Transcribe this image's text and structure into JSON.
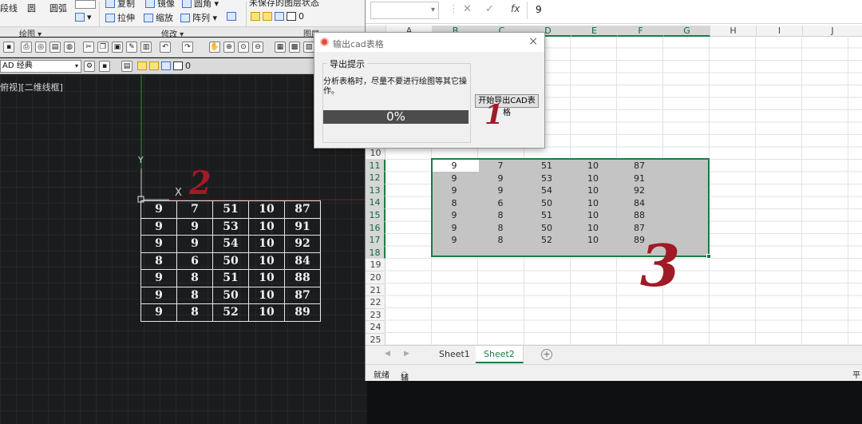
{
  "cad": {
    "ribbon": {
      "draw_items": [
        "段线",
        "圆",
        "圆弧"
      ],
      "modify_items": [
        "复制",
        "镜像",
        "圆角",
        "拉伸",
        "缩放",
        "阵列"
      ],
      "layer_state": "未保存的图层状态",
      "layer_zero": "0",
      "groups": {
        "draw": "绘图 ▾",
        "modify": "修改 ▾",
        "layer": "图层 ▾"
      }
    },
    "workspace": "AD 经典",
    "layer_value": "0",
    "viewport_label": "俯视][二维线框]",
    "ucs_y": "Y",
    "ucs_x": "X",
    "table": [
      [
        "9",
        "7",
        "51",
        "10",
        "87"
      ],
      [
        "9",
        "9",
        "53",
        "10",
        "91"
      ],
      [
        "9",
        "9",
        "54",
        "10",
        "92"
      ],
      [
        "8",
        "6",
        "50",
        "10",
        "84"
      ],
      [
        "9",
        "8",
        "51",
        "10",
        "88"
      ],
      [
        "9",
        "8",
        "50",
        "10",
        "87"
      ],
      [
        "9",
        "8",
        "52",
        "10",
        "89"
      ]
    ]
  },
  "excel": {
    "formula_value": "9",
    "fx": "fx",
    "columns": [
      "A",
      "B",
      "C",
      "D",
      "E",
      "F",
      "G",
      "H",
      "I",
      "J"
    ],
    "rows_visible": [
      "10",
      "11",
      "12",
      "13",
      "14",
      "15",
      "16",
      "17",
      "18",
      "19",
      "20",
      "21",
      "22",
      "23",
      "24",
      "25"
    ],
    "data": [
      [
        "9",
        "7",
        "51",
        "10",
        "87"
      ],
      [
        "9",
        "9",
        "53",
        "10",
        "91"
      ],
      [
        "9",
        "9",
        "54",
        "10",
        "92"
      ],
      [
        "8",
        "6",
        "50",
        "10",
        "84"
      ],
      [
        "9",
        "8",
        "51",
        "10",
        "88"
      ],
      [
        "9",
        "8",
        "50",
        "10",
        "87"
      ],
      [
        "9",
        "8",
        "52",
        "10",
        "89"
      ]
    ],
    "sheets": [
      "Sheet1",
      "Sheet2"
    ],
    "active_sheet": "Sheet2",
    "add_sheet": "+",
    "status": {
      "ready": "就绪",
      "accessibility": "辅助功能: 调查",
      "right": "平"
    }
  },
  "dialog": {
    "title": "输出cad表格",
    "close": "×",
    "group_label": "导出提示",
    "message": "分析表格时，尽量不要进行绘图等其它操作。",
    "progress": "0%",
    "progress_value": 0,
    "start_button": "开始导出CAD表格"
  },
  "annotations": {
    "one": "1",
    "two": "2",
    "three": "3"
  },
  "colors": {
    "excel_green": "#1e7b45",
    "annotation_red": "#9f1b26",
    "cad_bg": "#1b1c1e"
  }
}
